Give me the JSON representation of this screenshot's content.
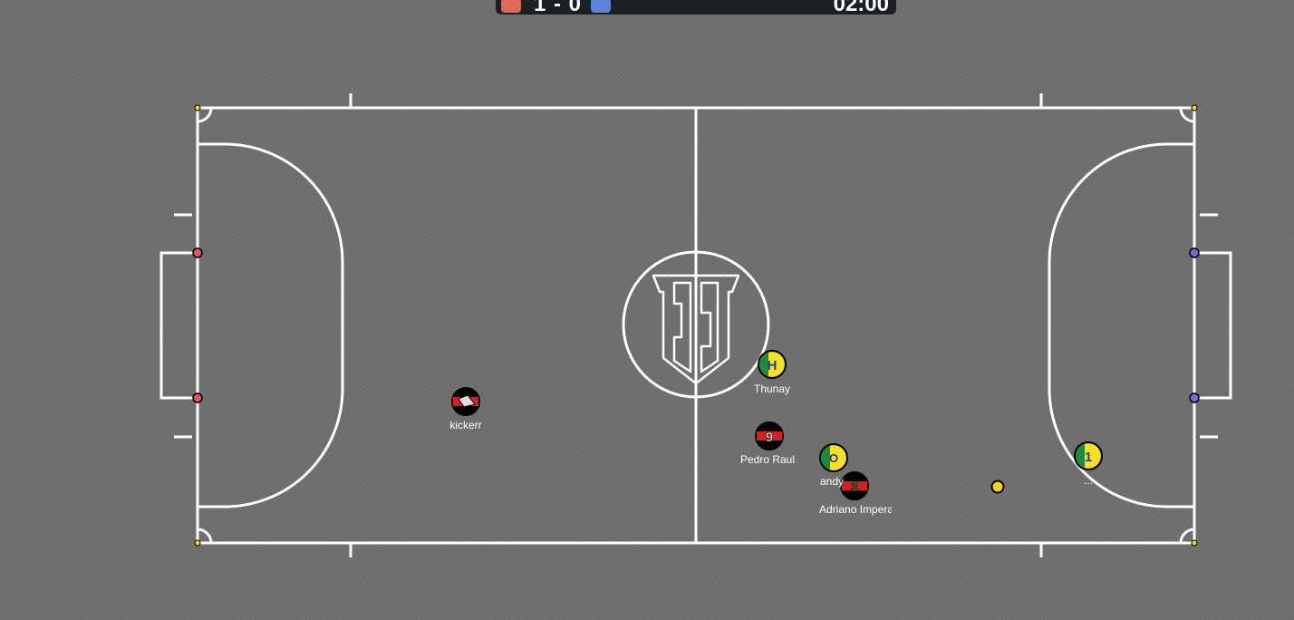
{
  "scoreboard": {
    "score": "1 - 0",
    "time": "02:00",
    "red_color": "#e06a5e",
    "blue_color": "#5f82e0"
  },
  "players": [
    {
      "id": "kickerr",
      "name": "kickerr",
      "badge": "boot",
      "kit": "red-black"
    },
    {
      "id": "thunay",
      "name": "Thunay",
      "badge": "H",
      "kit": "green-yellow"
    },
    {
      "id": "pedro",
      "name": "Pedro Raul",
      "badge": "9",
      "kit": "red-black"
    },
    {
      "id": "andy",
      "name": "andy",
      "badge": "O",
      "kit": "green-yellow"
    },
    {
      "id": "adriano",
      "name": "Adriano Imperador",
      "badge": "3",
      "kit": "red-black"
    },
    {
      "id": "keeper",
      "name": "...",
      "badge": "1",
      "kit": "green-yellow"
    }
  ],
  "ball": {
    "color": "#f2d21b"
  },
  "posts": {
    "red": "#e0585a",
    "blue": "#6a6ee0",
    "corner": "#f2d21b"
  }
}
